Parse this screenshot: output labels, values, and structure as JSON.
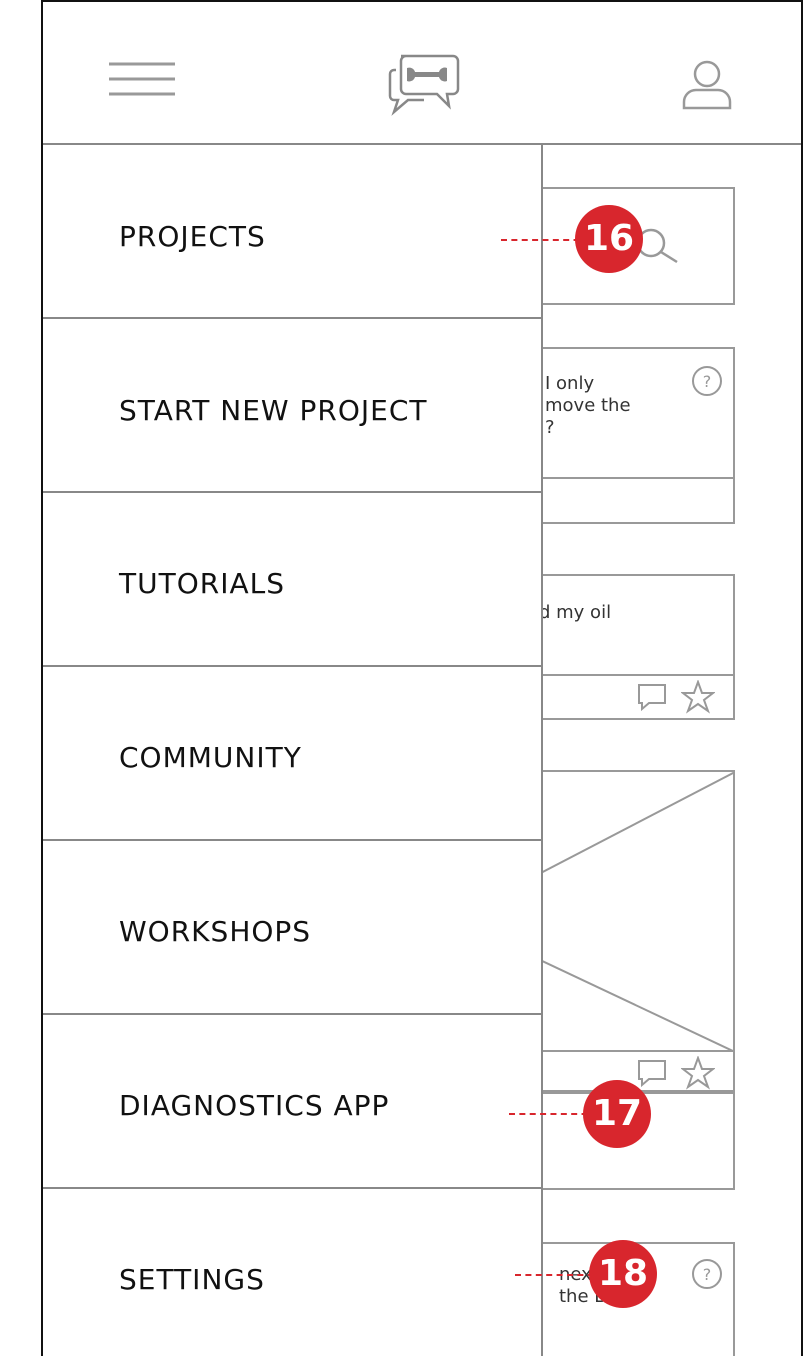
{
  "header": {
    "menu_icon": "hamburger-menu-icon",
    "logo_icon": "wrench-chat-logo-icon",
    "profile_icon": "user-profile-icon"
  },
  "background": {
    "search_icon": "search-icon",
    "card1": {
      "text": "I only\nmove the\n?",
      "help_icon": "question-circle-icon"
    },
    "card2": {
      "text": "d my oil",
      "comment_icon": "comment-icon",
      "star_icon": "star-icon"
    },
    "card3": {
      "image_placeholder": "image-placeholder-icon",
      "comment_icon": "comment-icon",
      "star_icon": "star-icon"
    },
    "card5": {
      "text": "nex\nthe B",
      "help_icon": "question-circle-icon"
    }
  },
  "drawer": {
    "items": [
      {
        "label": "PROJECTS"
      },
      {
        "label": "START NEW PROJECT"
      },
      {
        "label": "TUTORIALS"
      },
      {
        "label": "COMMUNITY"
      },
      {
        "label": "WORKSHOPS"
      },
      {
        "label": "DIAGNOSTICS APP"
      },
      {
        "label": "SETTINGS"
      }
    ]
  },
  "annotations": {
    "callouts": [
      "16",
      "17",
      "18"
    ],
    "accent_color": "#d8262d"
  }
}
